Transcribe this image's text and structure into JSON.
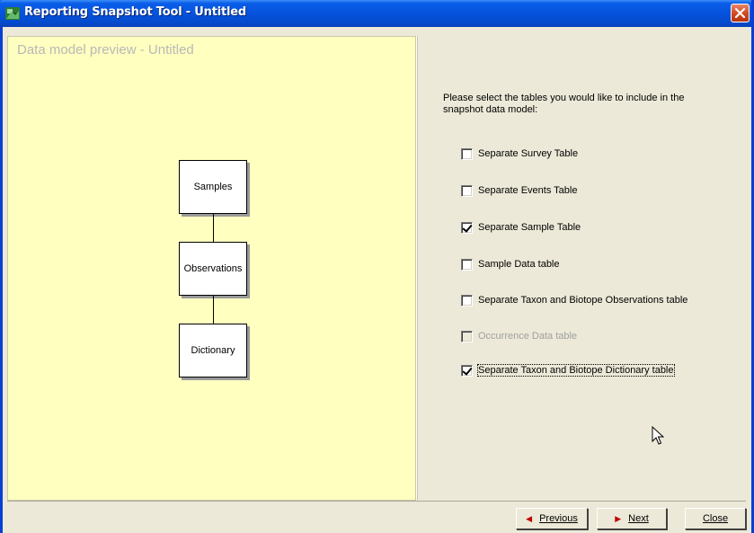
{
  "window": {
    "title": "Reporting Snapshot Tool - Untitled"
  },
  "preview": {
    "title": "Data model preview - Untitled",
    "nodes": [
      "Samples",
      "Observations",
      "Dictionary"
    ]
  },
  "selection": {
    "prompt": "Please select the tables you would like to include in the snapshot data model:",
    "options": [
      {
        "label": "Separate Survey Table",
        "checked": false,
        "enabled": true
      },
      {
        "label": "Separate Events Table",
        "checked": false,
        "enabled": true
      },
      {
        "label": "Separate Sample Table",
        "checked": true,
        "enabled": true
      },
      {
        "label": "Sample Data table",
        "checked": false,
        "enabled": true
      },
      {
        "label": "Separate Taxon and Biotope Observations table",
        "checked": false,
        "enabled": true
      },
      {
        "label": "Occurrence Data table",
        "checked": false,
        "enabled": false
      },
      {
        "label": "Separate Taxon and Biotope Dictionary table",
        "checked": true,
        "enabled": true
      }
    ]
  },
  "buttons": {
    "previous": "Previous",
    "next": "Next",
    "close": "Close"
  },
  "icons": {
    "app": "app-icon",
    "close": "close-icon",
    "cursor": "mouse-pointer-icon"
  }
}
